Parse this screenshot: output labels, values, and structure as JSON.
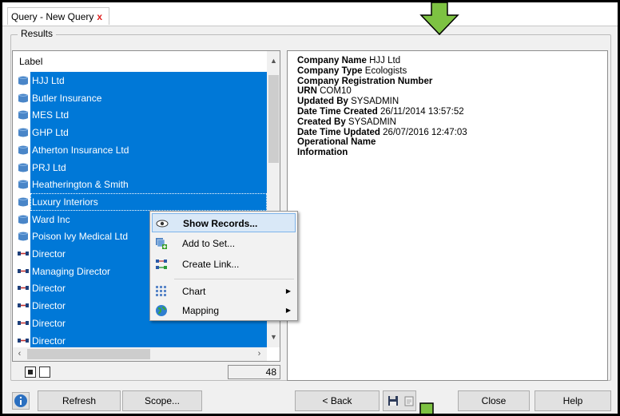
{
  "tab": {
    "title": "Query - New Query",
    "close": "x"
  },
  "results": {
    "title": "Results",
    "column_header": "Label",
    "items": [
      {
        "label": "HJJ Ltd",
        "icon": "company-icon"
      },
      {
        "label": "Butler Insurance",
        "icon": "company-icon"
      },
      {
        "label": "MES Ltd",
        "icon": "company-icon"
      },
      {
        "label": "GHP Ltd",
        "icon": "company-icon"
      },
      {
        "label": "Atherton Insurance Ltd",
        "icon": "company-icon"
      },
      {
        "label": "PRJ Ltd",
        "icon": "company-icon"
      },
      {
        "label": "Heatherington & Smith",
        "icon": "company-icon"
      },
      {
        "label": "Luxury Interiors",
        "icon": "company-icon"
      },
      {
        "label": "Ward Inc",
        "icon": "company-icon"
      },
      {
        "label": "Poison Ivy Medical Ltd",
        "icon": "company-icon"
      },
      {
        "label": "Director",
        "icon": "link-icon"
      },
      {
        "label": "Managing Director",
        "icon": "link-icon"
      },
      {
        "label": "Director",
        "icon": "link-icon"
      },
      {
        "label": "Director",
        "icon": "link-icon"
      },
      {
        "label": "Director",
        "icon": "link-icon"
      },
      {
        "label": "Director",
        "icon": "link-icon"
      }
    ],
    "count": "48"
  },
  "details": [
    {
      "key": "Company Name",
      "value": "HJJ Ltd"
    },
    {
      "key": "Company Type",
      "value": "Ecologists"
    },
    {
      "key": "Company Registration Number",
      "value": ""
    },
    {
      "key": "URN",
      "value": "COM10"
    },
    {
      "key": "Updated By",
      "value": "SYSADMIN"
    },
    {
      "key": "Date Time Created",
      "value": "26/11/2014 13:57:52"
    },
    {
      "key": "Created By",
      "value": "SYSADMIN"
    },
    {
      "key": "Date Time Updated",
      "value": "26/07/2016 12:47:03"
    },
    {
      "key": "Operational Name",
      "value": ""
    },
    {
      "key": "Information",
      "value": ""
    }
  ],
  "context_menu": [
    {
      "label": "Show Records...",
      "icon": "eye-icon",
      "submenu": false
    },
    {
      "label": "Add to Set...",
      "icon": "add-to-set-icon",
      "submenu": false
    },
    {
      "label": "Create Link...",
      "icon": "create-link-icon",
      "submenu": false
    },
    {
      "label": "Chart",
      "icon": "chart-icon",
      "submenu": true
    },
    {
      "label": "Mapping",
      "icon": "globe-icon",
      "submenu": true
    }
  ],
  "buttons": {
    "refresh": "Refresh",
    "scope": "Scope...",
    "back": "< Back",
    "close": "Close",
    "help": "Help"
  },
  "colors": {
    "selection": "#0078d7",
    "annotation_arrow": "#7dc242",
    "close_x": "#e02020"
  }
}
